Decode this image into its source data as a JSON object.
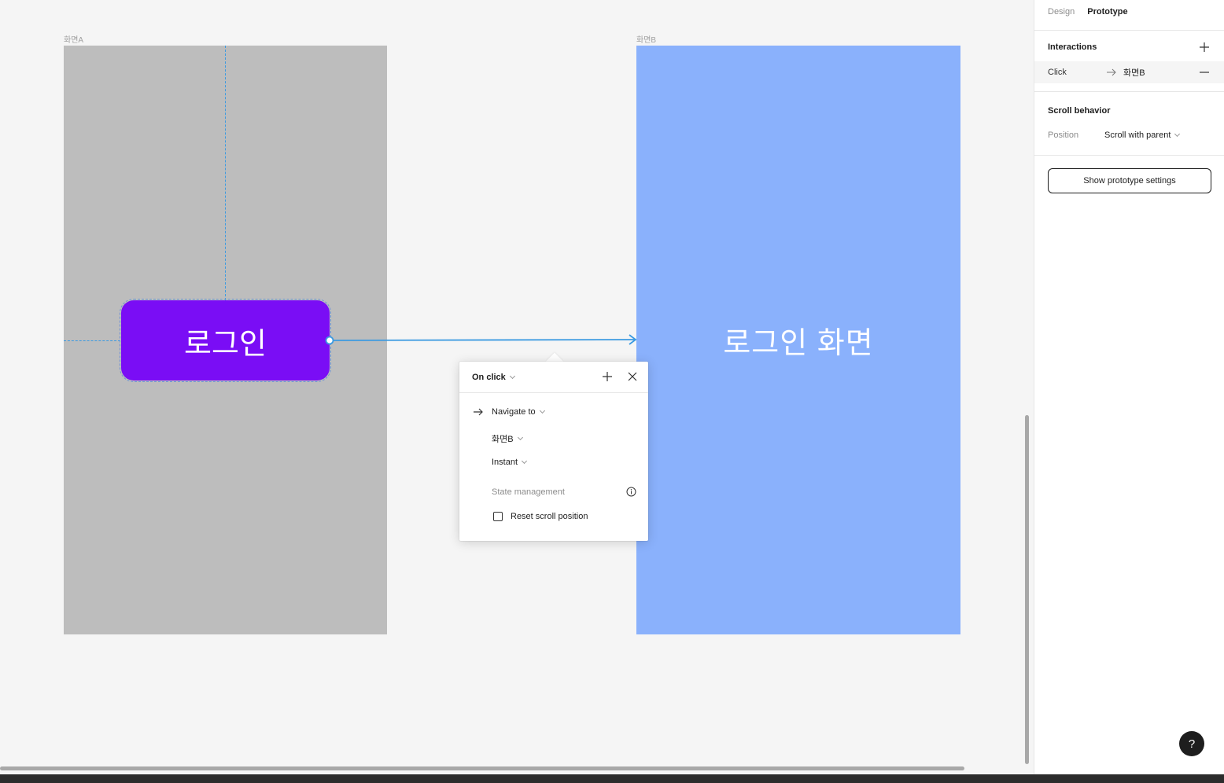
{
  "canvas": {
    "frame_a": {
      "label": "화면A",
      "button_text": "로그인",
      "fill": "#bdbdbd",
      "button_fill": "#7a0df5"
    },
    "frame_b": {
      "label": "화면B",
      "text": "로그인 화면",
      "fill": "#8ab1fc"
    },
    "connector_color": "#3b9ae1"
  },
  "popover": {
    "trigger": "On click",
    "action": "Navigate to",
    "destination": "화면B",
    "animation": "Instant",
    "state_management_label": "State management",
    "reset_scroll_label": "Reset scroll position",
    "reset_scroll_checked": false,
    "icons": {
      "add": "plus-icon",
      "close": "close-icon",
      "action": "arrow-right-icon",
      "info": "info-icon"
    }
  },
  "panel": {
    "tabs": [
      {
        "label": "Design",
        "active": false
      },
      {
        "label": "Prototype",
        "active": true
      }
    ],
    "interactions": {
      "title": "Interactions",
      "items": [
        {
          "trigger": "Click",
          "destination": "화면B"
        }
      ]
    },
    "scroll_behavior": {
      "title": "Scroll behavior",
      "position_label": "Position",
      "position_value": "Scroll with parent"
    },
    "settings_button": "Show prototype settings"
  },
  "help": {
    "label": "?"
  }
}
